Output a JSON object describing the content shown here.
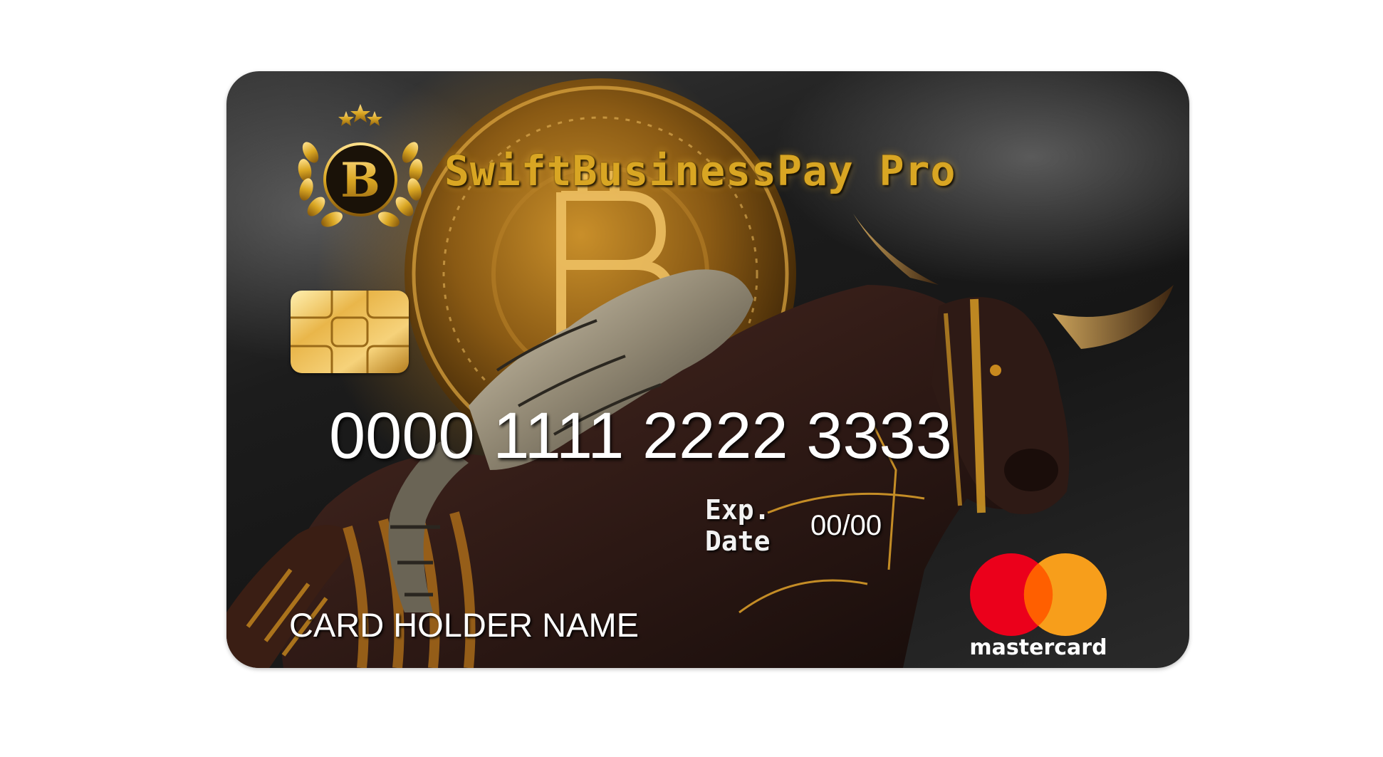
{
  "card": {
    "brand_name": "SwiftBusinessPay Pro",
    "number": "0000 1111 2222 3333",
    "expiry_label_line1": "Exp.",
    "expiry_label_line2": "Date",
    "expiry_value": "00/00",
    "holder_name": "CARD HOLDER NAME",
    "network_name": "mastercard"
  },
  "emblem": {
    "letter": "B",
    "icon": "bitcoin-laurel-emblem-icon"
  },
  "artwork": {
    "icons": [
      "bitcoin-coin-icon",
      "cyborg-bull-icon"
    ]
  },
  "colors": {
    "card_background": "#1c1c1c",
    "brand_gold": "#d9a623",
    "chip_gold": "#e9b64a",
    "mastercard_red": "#eb001b",
    "mastercard_orange": "#f79e1b",
    "mastercard_overlap": "#ff5f00",
    "text_white": "#ffffff"
  }
}
